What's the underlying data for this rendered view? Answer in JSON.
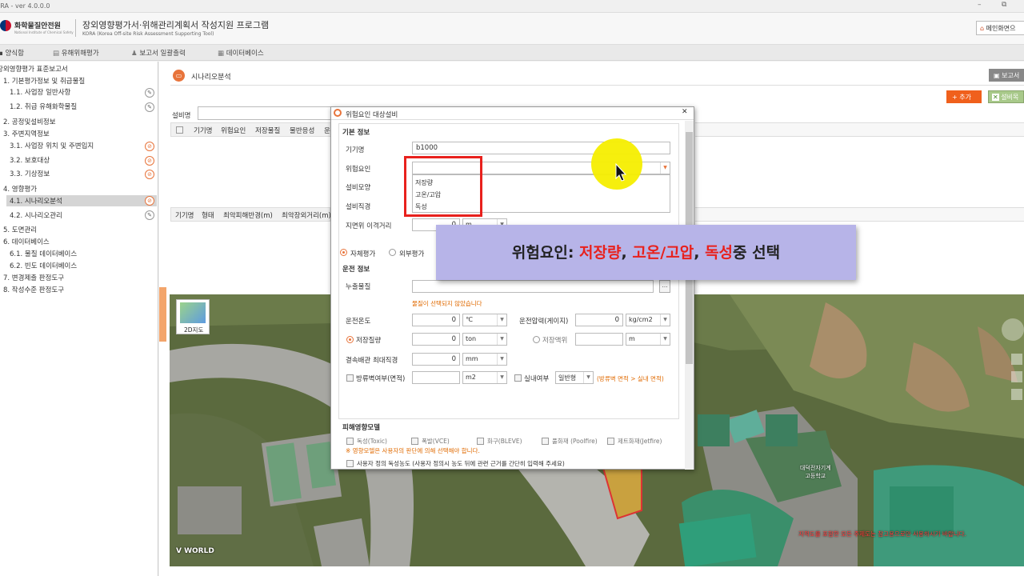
{
  "window": {
    "title": "ORA - ver 4.0.0.0",
    "restore_glyph": "⧉",
    "min_glyph": "–"
  },
  "header": {
    "org_name": "화학물질안전원",
    "org_sub": "National Institute of Chemical Safety",
    "title": "장외영향평가서·위해관리계획서 작성지원 프로그램",
    "subtitle": "KORA (Korea Off-site Risk Assessment Supporting Tool)",
    "main_button": "메인화면으"
  },
  "menubar": [
    "양식함",
    "유해위해평가",
    "보고서 일괄출력",
    "데이터베이스"
  ],
  "sidebar": {
    "items": [
      {
        "label": "장외영향평가 표준보고서",
        "level": 0
      },
      {
        "label": "1. 기본평가정보 및 취급물질",
        "level": 1
      },
      {
        "label": "1.1. 사업장 일반사항",
        "level": 2,
        "edit": "normal"
      },
      {
        "label": "1.2. 취급 유해화학물질",
        "level": 2,
        "edit": "normal"
      },
      {
        "label": "2. 공정및설비정보",
        "level": 1
      },
      {
        "label": "3. 주변지역정보",
        "level": 1
      },
      {
        "label": "3.1. 사업장 위치 및 주변입지",
        "level": 2,
        "edit": "warn"
      },
      {
        "label": "3.2. 보호대상",
        "level": 2,
        "edit": "warn"
      },
      {
        "label": "3.3. 기상정보",
        "level": 2,
        "edit": "warn"
      },
      {
        "label": "4. 영향평가",
        "level": 1
      },
      {
        "label": "4.1. 시나리오분석",
        "level": 2,
        "edit": "warn",
        "selected": true
      },
      {
        "label": "4.2. 시나리오관리",
        "level": 2,
        "edit": "normal"
      },
      {
        "label": "5. 도면관리",
        "level": 1
      },
      {
        "label": "6. 데이터베이스",
        "level": 1
      },
      {
        "label": "6.1. 물질 데이터베이스",
        "level": 2
      },
      {
        "label": "6.2. 빈도 데이터베이스",
        "level": 2
      },
      {
        "label": "7. 변경제출 판정도구",
        "level": 1
      },
      {
        "label": "8. 작성수준 판정도구",
        "level": 1
      }
    ]
  },
  "main": {
    "page_title": "시나리오분석",
    "report_button": "보고서",
    "add_button": "+ 추가",
    "excel_button": "설비목",
    "equipment_label": "설비명",
    "table1_headers": [
      "기기명",
      "위험요인",
      "저장물질",
      "물반응성",
      "운"
    ],
    "table2_headers": [
      "기기명",
      "형태",
      "최악피해반경(m)",
      "최악장외거리(m)"
    ],
    "map_badge": "2D지도",
    "map_logo": "V WORLD",
    "map_school_label": "대덕전자기계\n고등학교",
    "map_notice": "지적도를 포함한 모든 주제도는 참고용으로만 사용하시기 바랍니다."
  },
  "dialog": {
    "title": "위험요인 대상설비",
    "close": "✕",
    "section_basic": "기본 정보",
    "fields": {
      "device_name_label": "기기명",
      "device_name_value": "b1000",
      "hazard_label": "위험요인",
      "hazard_value": "",
      "shape_label": "설비모양",
      "diameter_label": "설비직경",
      "ground_label": "지면위 이격거리",
      "ground_value": "0",
      "ground_unit": "m"
    },
    "hazard_options": [
      "저장량",
      "고온/고압",
      "독성"
    ],
    "eval_internal": "자체평가",
    "eval_external": "외부평가",
    "section_operation": "운전 정보",
    "leak_label": "누출물질",
    "leak_warning": "물질이 선택되지 않았습니다",
    "op_temp_label": "운전온도",
    "op_temp_value": "0",
    "op_temp_unit": "℃",
    "op_pressure_label": "운전압력(게이지)",
    "op_pressure_value": "0",
    "op_pressure_unit": "kg/cm2",
    "storage_mass_label": "저장질량",
    "storage_mass_value": "0",
    "storage_mass_unit": "ton",
    "storage_level_label": "저장액위",
    "storage_level_value": "",
    "storage_level_unit": "m",
    "pipe_label": "결속배관 최대직경",
    "pipe_value": "0",
    "pipe_unit": "mm",
    "dike_label": "방류벽여부(면적)",
    "dike_value": "",
    "dike_unit": "m2",
    "indoor_label": "실내여부",
    "indoor_value": "일반형",
    "indoor_note": "(방류벽 면적 > 실내 면적)",
    "section_damage": "피해영향모델",
    "models": [
      "독성(Toxic)",
      "폭발(VCE)",
      "화구(BLEVE)",
      "풀화재 (Poolfire)",
      "제트화재(Jetfire)"
    ],
    "model_note": "※ 영향모델은 사용자의 판단에 의해 선택해야 합니다.",
    "user_toxic": "사용자 정의 독성농도 (사용자 정의시 농도 뒤에 관련 근거를 간단히 입력해 주세요)"
  },
  "callout": {
    "prefix": "위험요인: ",
    "opt1": "저장량",
    "sep1": ", ",
    "opt2": "고온/고압",
    "sep2": ", ",
    "opt3": "독성",
    "suffix": "중 선택"
  },
  "colors": {
    "accent": "#e8743b",
    "highlight_box": "#e8211d",
    "callout_bg": "#b7b4e8",
    "warn_text": "#e06a00",
    "cursor_halo": "#f5ee00"
  }
}
